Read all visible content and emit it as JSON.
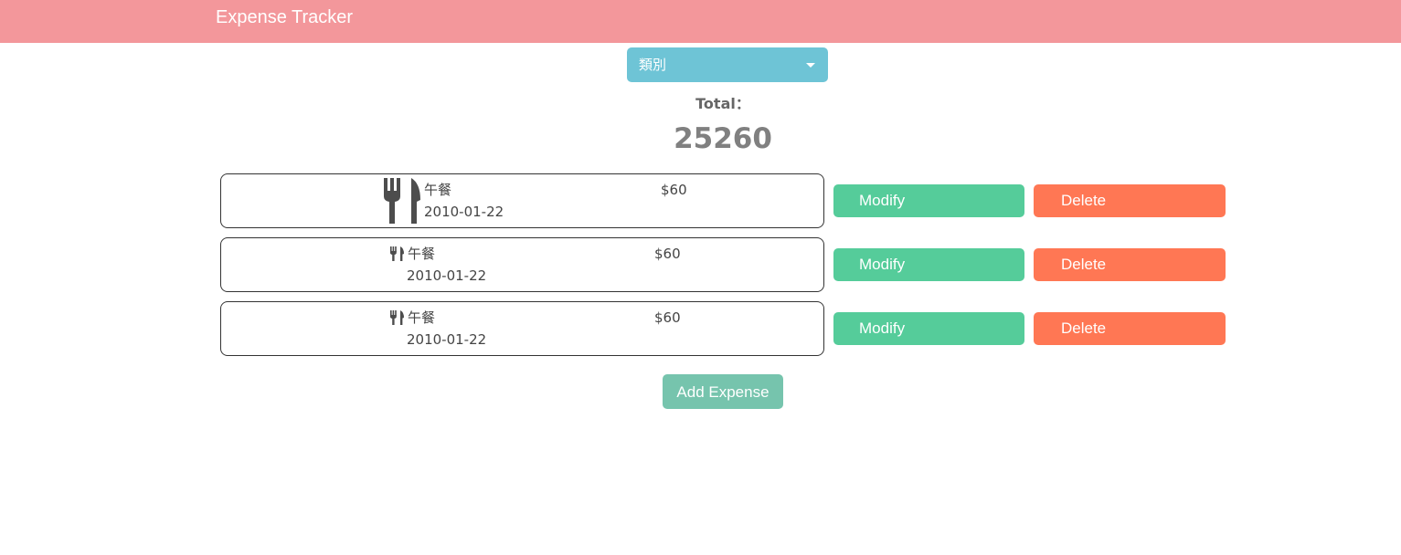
{
  "app": {
    "title": "Expense Tracker"
  },
  "filter": {
    "category_label": "類別"
  },
  "summary": {
    "total_label": "Total：",
    "total_value": "25260"
  },
  "expenses": [
    {
      "title": "午餐",
      "date": "2010-01-22",
      "amount": "$60",
      "icon": "utensils-icon"
    },
    {
      "title": "午餐",
      "date": "2010-01-22",
      "amount": "$60",
      "icon": "utensils-icon"
    },
    {
      "title": "午餐",
      "date": "2010-01-22",
      "amount": "$60",
      "icon": "utensils-icon"
    }
  ],
  "actions": {
    "modify_label": "Modify",
    "delete_label": "Delete",
    "add_label": "Add Expense"
  },
  "colors": {
    "header": "#f3979b",
    "select": "#6ec4d6",
    "modify": "#55cc9a",
    "delete": "#ff7754",
    "add": "#76c4ad"
  }
}
